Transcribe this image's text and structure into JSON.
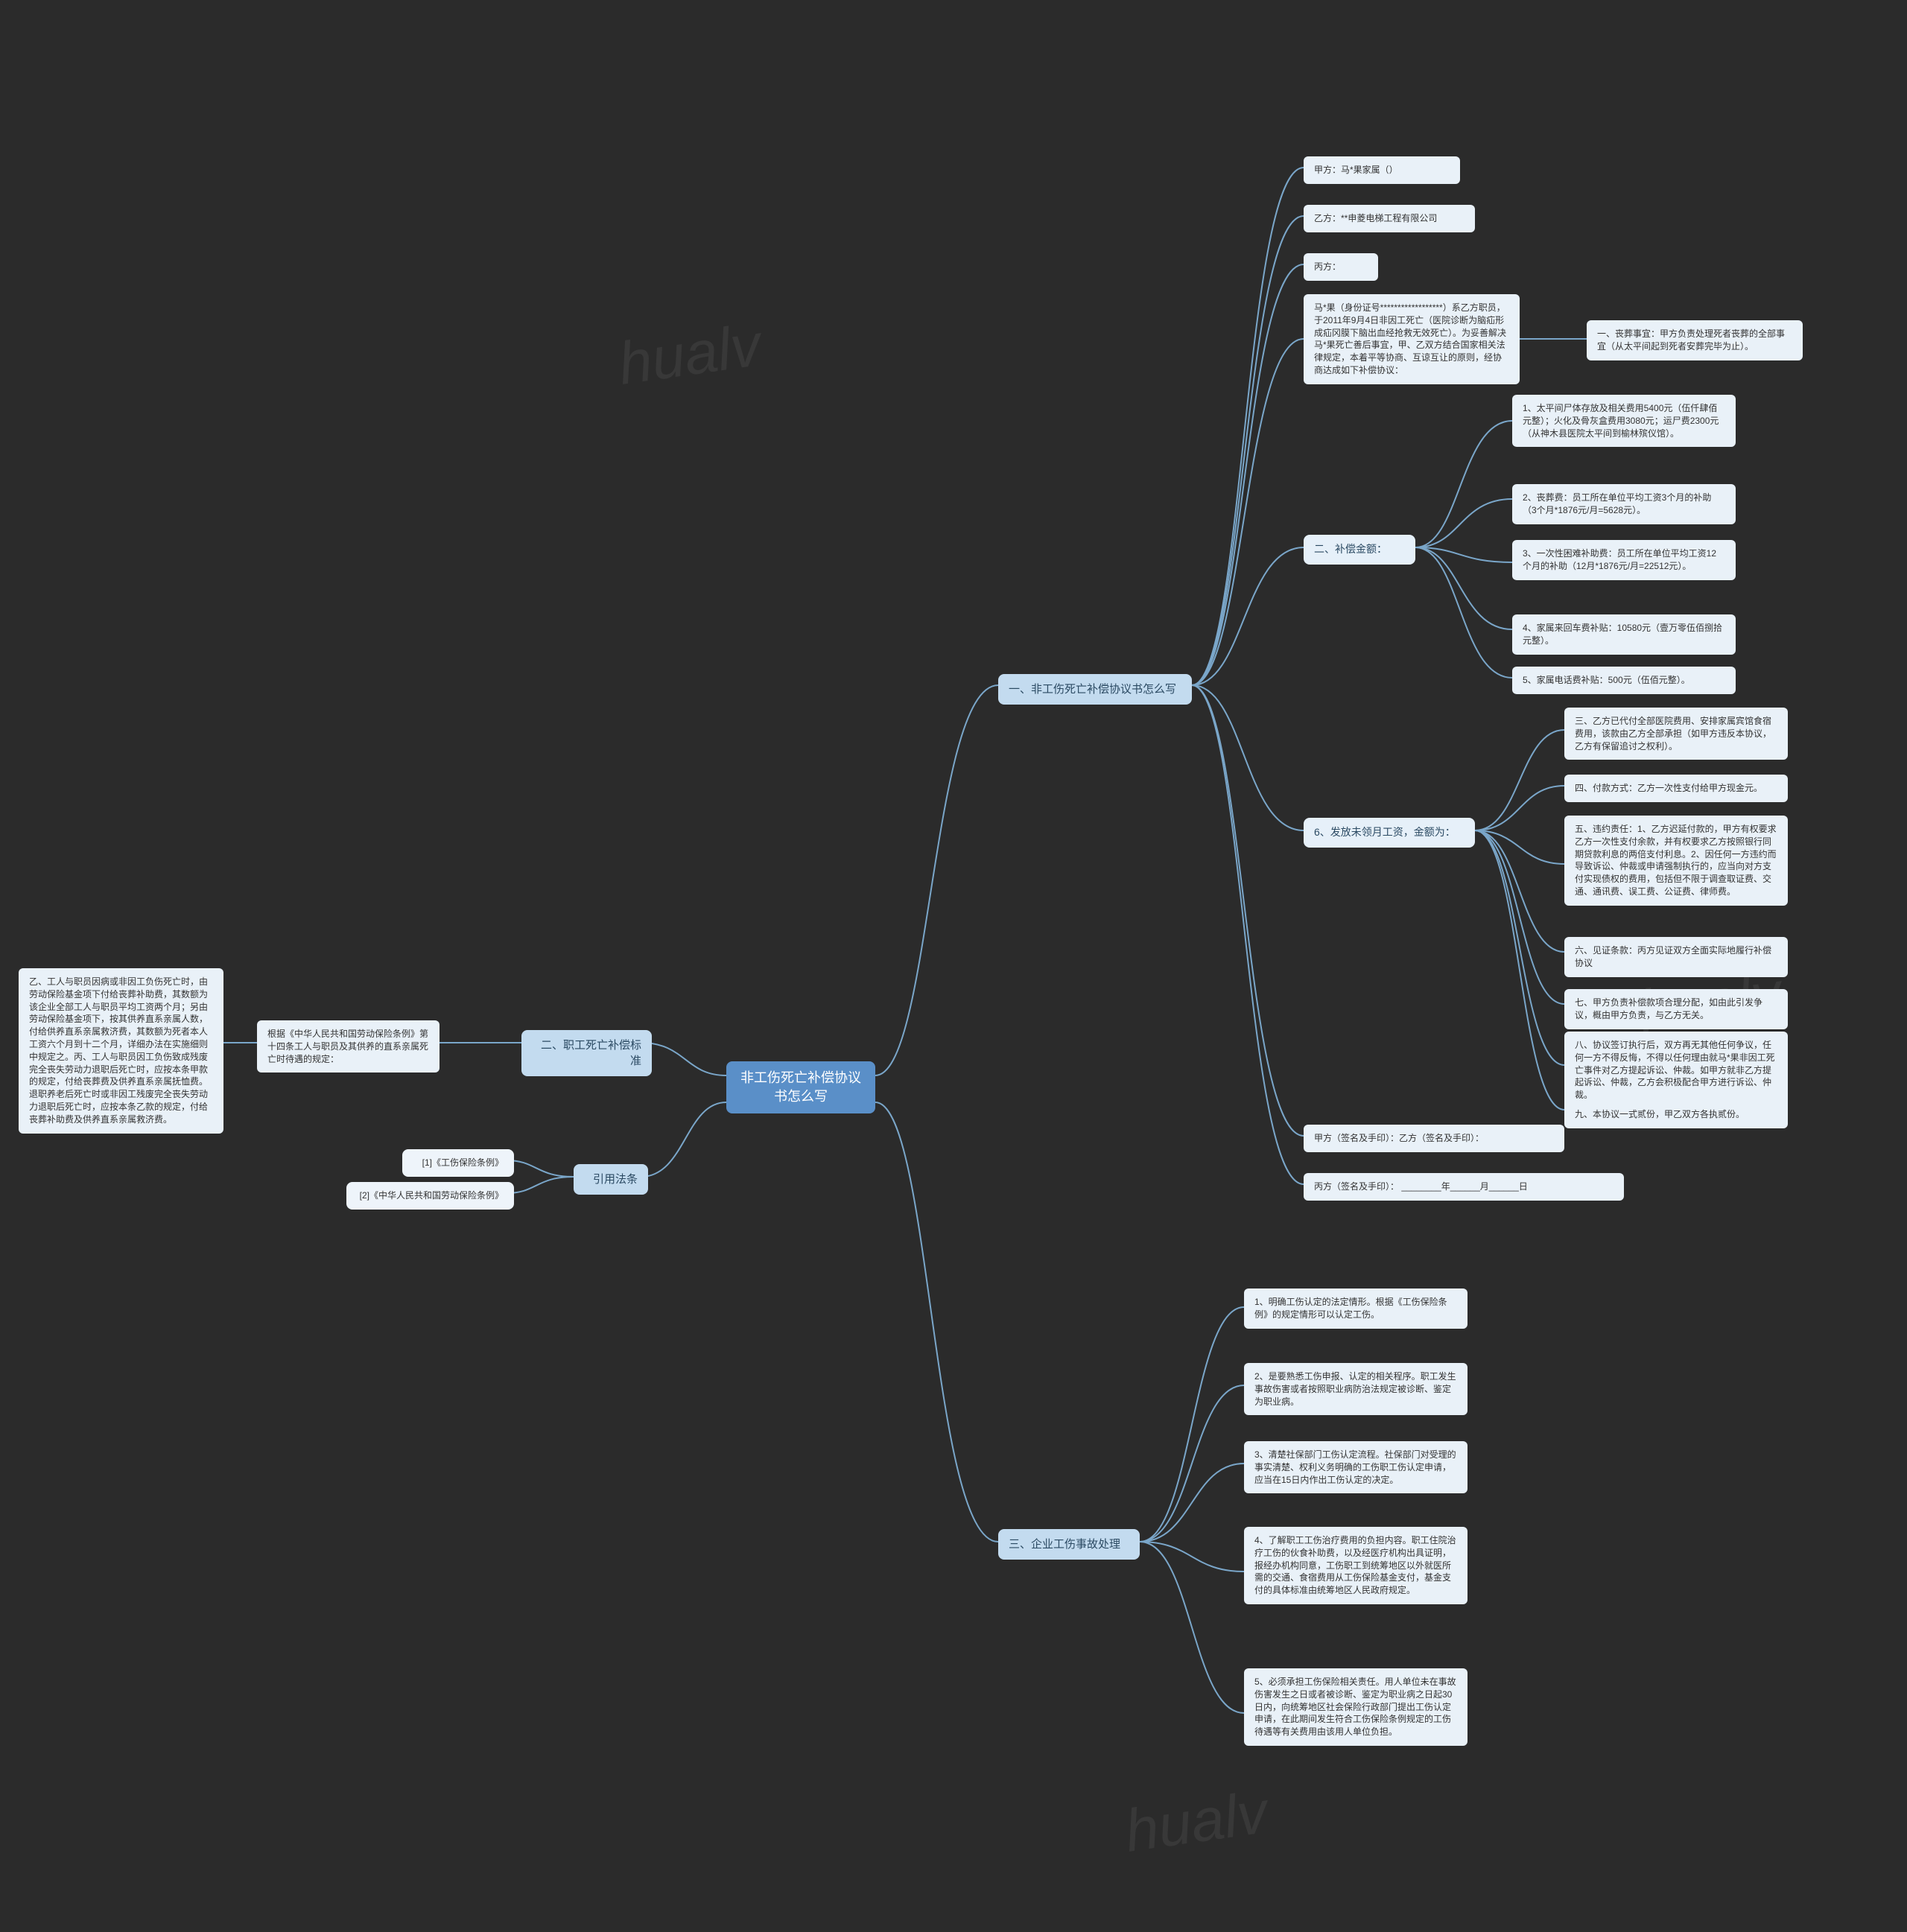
{
  "root": "非工伤死亡补偿协议书怎么写",
  "b1": {
    "title": "一、非工伤死亡补偿协议书怎么写",
    "partyA": "甲方：马*果家属（）",
    "partyB": "乙方：**申菱电梯工程有限公司",
    "partyC": "丙方：",
    "preamble": "马*果（身份证号******************）系乙方职员，于2011年9月4日非因工死亡（医院诊断为脑疝形成疝冈膜下脑出血经抢救无效死亡）。为妥善解决马*果死亡善后事宜，甲、乙双方结合国家相关法律规定，本着平等协商、互谅互让的原则，经协商达成如下补偿协议：",
    "clause1": "一、丧葬事宜：甲方负责处理死者丧葬的全部事宜（从太平间起到死者安葬完毕为止）。",
    "clause2t": "二、补偿金额：",
    "c2_1": "1、太平间尸体存放及相关费用5400元（伍仟肆佰元整）；火化及骨灰盒费用3080元；运尸费2300元（从神木县医院太平间到榆林殡仪馆）。",
    "c2_2": "2、丧葬费：员工所在单位平均工资3个月的补助（3个月*1876元/月=5628元）。",
    "c2_3": "3、一次性困难补助费：员工所在单位平均工资12个月的补助（12月*1876元/月=22512元）。",
    "c2_4": "4、家属来回车费补贴：10580元（壹万零伍佰捌拾元整）。",
    "c2_5": "5、家属电话费补贴：500元（伍佰元整）。",
    "clause6t": "6、发放未领月工资，金额为：",
    "c6_3": "三、乙方已代付全部医院费用、安排家属宾馆食宿费用，该款由乙方全部承担（如甲方违反本协议，乙方有保留追讨之权利）。",
    "c6_4": "四、付款方式：乙方一次性支付给甲方现金元。",
    "c6_5": "五、违约责任：1、乙方迟延付款的，甲方有权要求乙方一次性支付余款，并有权要求乙方按照银行同期贷款利息的两倍支付利息。2、因任何一方违约而导致诉讼、仲裁或申请强制执行的，应当向对方支付实现债权的费用，包括但不限于调查取证费、交通、通讯费、误工费、公证费、律师费。",
    "c6_6": "六、见证条款：丙方见证双方全面实际地履行补偿协议",
    "c6_7": "七、甲方负责补偿款项合理分配，如由此引发争议，概由甲方负责，与乙方无关。",
    "c6_8": "八、协议签订执行后，双方再无其他任何争议，任何一方不得反悔，不得以任何理由就马*果非因工死亡事件对乙方提起诉讼、仲裁。如甲方就非乙方提起诉讼、仲裁，乙方会积极配合甲方进行诉讼、仲裁。",
    "c6_9": "九、本协议一式贰份，甲乙双方各执贰份。",
    "sig1": "甲方（签名及手印）：乙方（签名及手印）：",
    "sig2": "丙方（签名及手印）：              ________年______月______日"
  },
  "b2": {
    "title": "二、职工死亡补偿标准",
    "sub": "根据《中华人民共和国劳动保险条例》第十四条工人与职员及其供养的直系亲属死亡时待遇的规定：",
    "detail": "乙、工人与职员因病或非因工负伤死亡时，由劳动保险基金项下付给丧葬补助费，其数额为该企业全部工人与职员平均工资两个月；另由劳动保险基金项下，按其供养直系亲属人数，付给供养直系亲属救济费，其数额为死者本人工资六个月到十二个月，详细办法在实施细则中规定之。丙、工人与职员因工负伤致成残废完全丧失劳动力退职后死亡时，应按本条甲款的规定，付给丧葬费及供养直系亲属抚恤费。退职养老后死亡时或非因工残废完全丧失劳动力退职后死亡时，应按本条乙款的规定，付给丧葬补助费及供养直系亲属救济费。"
  },
  "cite": {
    "title": "引用法条",
    "r1": "[1]《工伤保险条例》",
    "r2": "[2]《中华人民共和国劳动保险条例》"
  },
  "b3": {
    "title": "三、企业工伤事故处理",
    "i1": "1、明确工伤认定的法定情形。根据《工伤保险条例》的规定情形可以认定工伤。",
    "i2": "2、是要熟悉工伤申报、认定的相关程序。职工发生事故伤害或者按照职业病防治法规定被诊断、鉴定为职业病。",
    "i3": "3、清楚社保部门工伤认定流程。社保部门对受理的事实清楚、权利义务明确的工伤职工伤认定申请，应当在15日内作出工伤认定的决定。",
    "i4": "4、了解职工工伤治疗费用的负担内容。职工住院治疗工伤的伙食补助费，以及经医疗机构出具证明，报经办机构同意，工伤职工到统筹地区以外就医所需的交通、食宿费用从工伤保险基金支付，基金支付的具体标准由统筹地区人民政府规定。",
    "i5": "5、必须承担工伤保险相关责任。用人单位未在事故伤害发生之日或者被诊断、鉴定为职业病之日起30日内，向统筹地区社会保险行政部门提出工伤认定申请，在此期间发生符合工伤保险条例规定的工伤待遇等有关费用由该用人单位负担。"
  },
  "wm": "hualv"
}
